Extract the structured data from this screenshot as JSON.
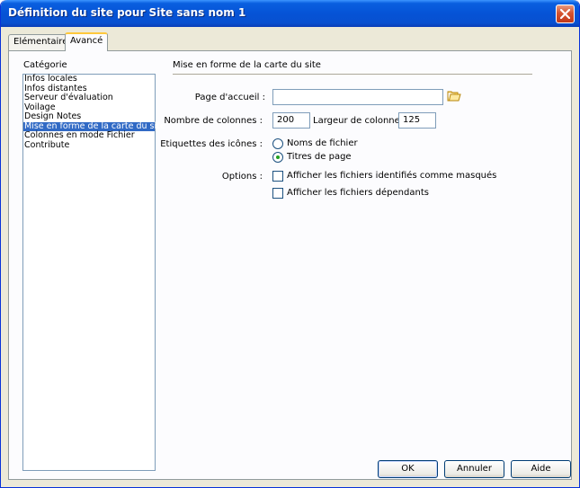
{
  "window": {
    "title": "Définition du site pour Site sans nom 1"
  },
  "tabs": [
    {
      "label": "Elémentaire"
    },
    {
      "label": "Avancé"
    }
  ],
  "category": {
    "label": "Catégorie",
    "items": [
      "Infos locales",
      "Infos distantes",
      "Serveur d'évaluation",
      "Voilage",
      "Design Notes",
      "Mise en forme de la carte du site",
      "Colonnes en mode Fichier",
      "Contribute"
    ],
    "selected": "Mise en forme de la carte du site"
  },
  "section": {
    "title": "Mise en forme de la carte du site"
  },
  "form": {
    "home_page_label": "Page d'accueil :",
    "home_page_value": "",
    "columns_label": "Nombre de colonnes :",
    "columns_value": "200",
    "column_width_label": "Largeur de colonne :",
    "column_width_value": "125",
    "icon_labels_label": "Etiquettes des icônes :",
    "radio_filenames": "Noms de fichier",
    "radio_titles": "Titres de page",
    "radio_selected": "Titres de page",
    "options_label": "Options :",
    "check_hidden": "Afficher les fichiers identifiés comme masqués",
    "check_dependent": "Afficher les fichiers dépendants"
  },
  "buttons": {
    "ok": "OK",
    "cancel": "Annuler",
    "help": "Aide"
  },
  "colors": {
    "titlebar": "#0553d6",
    "selection": "#316ac5",
    "tab_highlight": "#ffc83c"
  }
}
